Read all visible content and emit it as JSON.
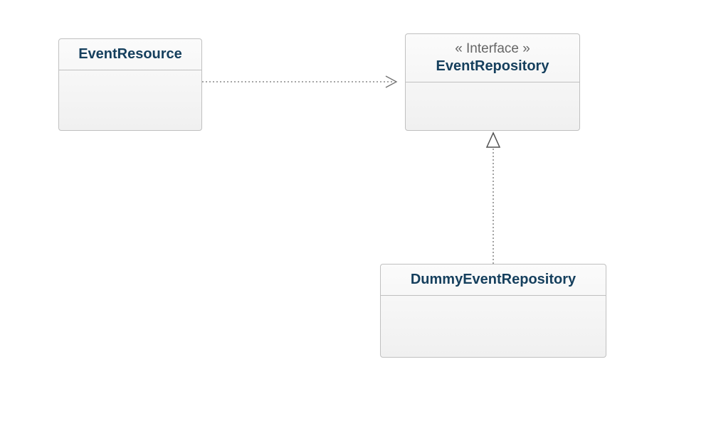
{
  "classes": {
    "eventResource": {
      "name": "EventResource"
    },
    "eventRepository": {
      "stereotype": "« Interface »",
      "name": "EventRepository"
    },
    "dummyEventRepository": {
      "name": "DummyEventRepository"
    }
  }
}
